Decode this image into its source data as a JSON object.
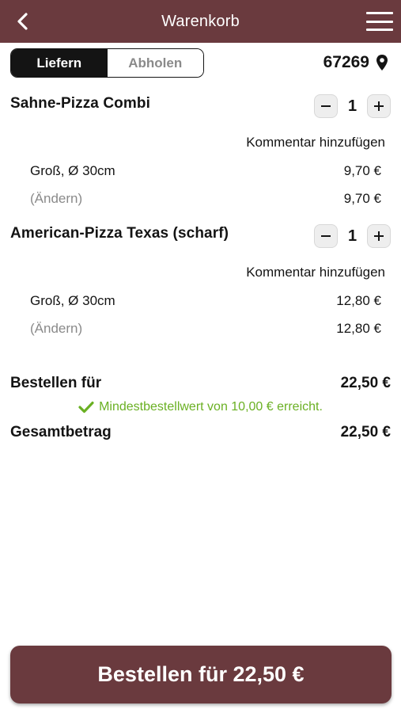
{
  "header": {
    "title": "Warenkorb"
  },
  "delivery": {
    "options": [
      "Liefern",
      "Abholen"
    ],
    "selected": "Liefern",
    "zip": "67269"
  },
  "items": [
    {
      "name": "Sahne-Pizza Combi",
      "quantity": "1",
      "comment_label": "Kommentar hinzufügen",
      "option_label": "Groß, Ø 30cm",
      "option_price": "9,70 €",
      "change_label": "(Ändern)",
      "line_total": "9,70 €"
    },
    {
      "name": "American-Pizza Texas (scharf)",
      "quantity": "1",
      "comment_label": "Kommentar hinzufügen",
      "option_label": "Groß, Ø 30cm",
      "option_price": "12,80 €",
      "change_label": "(Ändern)",
      "line_total": "12,80 €"
    }
  ],
  "summary": {
    "order_for_label": "Bestellen für",
    "order_for_value": "22,50 €",
    "min_order_note": "Mindestbestellwert von 10,00 € erreicht.",
    "total_label": "Gesamtbetrag",
    "total_value": "22,50 €"
  },
  "order_button": {
    "label": "Bestellen für 22,50 €"
  },
  "colors": {
    "brand": "#6a3a3e",
    "success": "#6ab023",
    "muted": "#8a8a8a"
  },
  "icons": [
    "back-chevron-icon",
    "hamburger-menu-icon",
    "location-pin-icon",
    "minus-icon",
    "plus-icon",
    "checkmark-icon"
  ]
}
